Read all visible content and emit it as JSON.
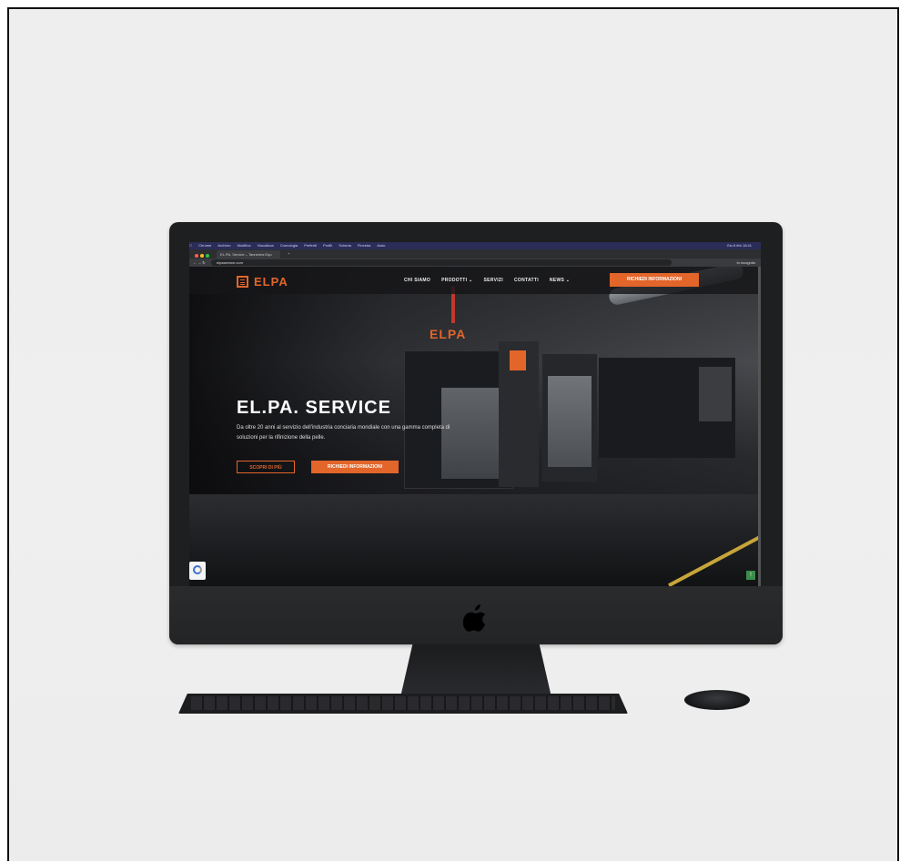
{
  "browser": {
    "menubar": [
      "Chrome",
      "Archivio",
      "Modifica",
      "Visualizza",
      "Cronologia",
      "Preferiti",
      "Profili",
      "Scheda",
      "Finestra",
      "Aiuto"
    ],
    "clock": "Gio 8 feb 18:41",
    "tab_title": "EL.PA. Service – Tanneries Equ",
    "url": "elpaservice.com",
    "profile": "In incognito"
  },
  "site": {
    "logo": "ELPA",
    "nav": [
      {
        "label": "CHI SIAMO"
      },
      {
        "label": "PRODOTTI ⌄"
      },
      {
        "label": "SERVIZI"
      },
      {
        "label": "CONTATTI"
      },
      {
        "label": "NEWS ⌄"
      }
    ],
    "cta_top": "RICHIEDI INFORMAZIONI",
    "machine_sign": "ELPA",
    "hero": {
      "title": "EL.PA. SERVICE",
      "subtitle": "Da oltre 20 anni al servizio dell'industria conciaria mondiale con una gamma completa di soluzioni per la rifinizione della pelle.",
      "btn_primary": "SCOPRI DI PIÙ",
      "btn_secondary": "RICHIEDI INFORMAZIONI"
    }
  },
  "colors": {
    "accent": "#e2652a",
    "menubar": "#2b2d59"
  }
}
